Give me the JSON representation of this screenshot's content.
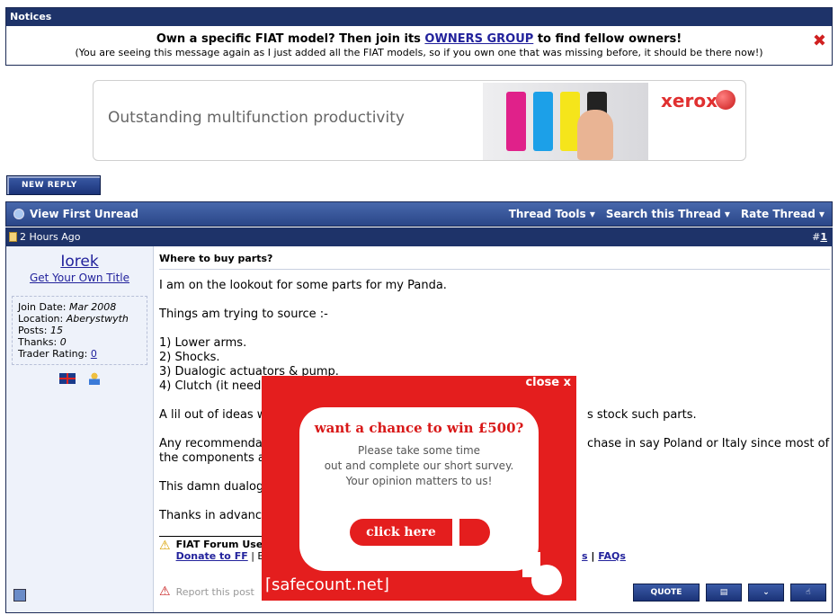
{
  "notices": {
    "header": "Notices",
    "line1_pre": "Own a specific FIAT model? Then join its ",
    "line1_link": "OWNERS GROUP",
    "line1_post": " to find fellow owners!",
    "line2": "(You are seeing this message again as I just added all the FIAT models, so if you own one that was missing before, it should be there now!)",
    "close": "✖"
  },
  "ad": {
    "tagline": "Outstanding multifunction productivity",
    "brand": "xerox"
  },
  "toolbar": {
    "new_reply": "NEW REPLY"
  },
  "thread_bar": {
    "view_first_unread": "View First Unread",
    "thread_tools": "Thread Tools",
    "search_thread": "Search this Thread",
    "rate_thread": "Rate Thread"
  },
  "post": {
    "date": "2 Hours Ago",
    "num_prefix": "#",
    "num": "1",
    "title": "Where to buy parts?",
    "paragraphs": [
      "I am on the lookout for some parts for my Panda.",
      "Things am trying to source :-",
      "1) Lower arms.\n2) Shocks.\n3) Dualogic actuators & pump.\n4) Clutch (it need",
      "A lil out of ideas w",
      "Any recommendati",
      "the components a",
      "This damn dualog",
      "Thanks in advanc"
    ],
    "p1": "I am on the lookout for some parts for my Panda.",
    "p2": "Things am trying to source :-",
    "l1": "1) Lower arms.",
    "l2": "2) Shocks.",
    "l3": "3) Dualogic actuators & pump.",
    "l4": "4) Clutch (it need",
    "p3a": "A lil out of ideas w",
    "p3b": "s stock such parts.",
    "p4a": "Any recommendati",
    "p4b": "chase in say Poland or Italy since most of",
    "p4c": "the components a",
    "p5": "This damn dualog",
    "p6": "Thanks in advanc",
    "sig_title": "FIAT Forum Use",
    "sig_link1": "Donate to FF",
    "sig_sep": " | B",
    "faqs_pre": "s",
    "faqs": "FAQs",
    "report": "Report this post",
    "quote": "QUOTE"
  },
  "user": {
    "name": "Iorek",
    "title_link": "Get Your Own Title",
    "join_label": "Join Date: ",
    "join": "Mar 2008",
    "location_label": "Location: ",
    "location": "Aberystwyth",
    "posts_label": "Posts: ",
    "posts": "15",
    "thanks_label": "Thanks: ",
    "thanks": "0",
    "trader_label": "Trader Rating: ",
    "trader": "0"
  },
  "popup": {
    "close": "close x",
    "headline": "want a chance to win £500?",
    "msg1": "Please take some time",
    "msg2": "out and complete our short survey.",
    "msg3": "Your opinion matters to us!",
    "cta": "click here",
    "brand": "⌈safecount.net⌋"
  }
}
